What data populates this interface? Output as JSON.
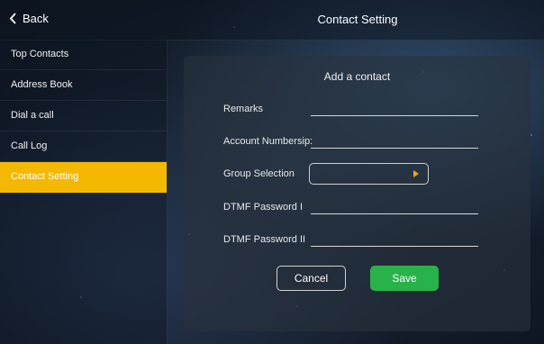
{
  "header": {
    "back_label": "Back",
    "title": "Contact Setting"
  },
  "sidebar": {
    "items": [
      {
        "label": "Top Contacts"
      },
      {
        "label": "Address Book"
      },
      {
        "label": "Dial a call"
      },
      {
        "label": "Call Log"
      },
      {
        "label": "Contact Setting"
      }
    ],
    "active_color": "#f5b800"
  },
  "form": {
    "title": "Add a contact",
    "remarks_label": "Remarks",
    "remarks_value": "",
    "account_label": "Account Number",
    "account_prefix": "sip:",
    "account_value": "",
    "group_label": "Group Selection",
    "group_value": "",
    "dtmf1_label": "DTMF Password I",
    "dtmf1_value": "",
    "dtmf2_label": "DTMF Password II",
    "dtmf2_value": "",
    "cancel_label": "Cancel",
    "save_label": "Save",
    "save_color": "#28b34a",
    "arrow_color": "#f5a800"
  }
}
